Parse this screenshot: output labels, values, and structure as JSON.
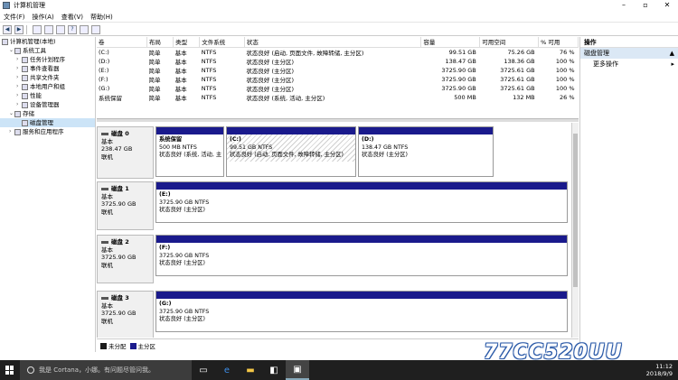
{
  "window": {
    "title": "计算机管理"
  },
  "menu": [
    "文件(F)",
    "操作(A)",
    "查看(V)",
    "帮助(H)"
  ],
  "tree": [
    {
      "label": "计算机管理(本地)",
      "level": 0,
      "icon": "computer-icon"
    },
    {
      "label": "系统工具",
      "level": 1,
      "icon": "tools-icon"
    },
    {
      "label": "任务计划程序",
      "level": 2,
      "icon": "clock-icon"
    },
    {
      "label": "事件查看器",
      "level": 2,
      "icon": "log-icon"
    },
    {
      "label": "共享文件夹",
      "level": 2,
      "icon": "folder-icon"
    },
    {
      "label": "本地用户和组",
      "level": 2,
      "icon": "users-icon"
    },
    {
      "label": "性能",
      "level": 2,
      "icon": "chart-icon"
    },
    {
      "label": "设备管理器",
      "level": 2,
      "icon": "device-icon"
    },
    {
      "label": "存储",
      "level": 1,
      "icon": "storage-icon"
    },
    {
      "label": "磁盘管理",
      "level": 2,
      "icon": "disk-icon",
      "selected": true
    },
    {
      "label": "服务和应用程序",
      "level": 1,
      "icon": "services-icon"
    }
  ],
  "volumes": {
    "headers": [
      "卷",
      "布局",
      "类型",
      "文件系统",
      "状态",
      "容量",
      "可用空间",
      "% 可用"
    ],
    "rows": [
      [
        "(C:)",
        "简单",
        "基本",
        "NTFS",
        "状态良好 (启动, 页面文件, 故障转储, 主分区)",
        "99.51 GB",
        "75.26 GB",
        "76 %"
      ],
      [
        "(D:)",
        "简单",
        "基本",
        "NTFS",
        "状态良好 (主分区)",
        "138.47 GB",
        "138.36 GB",
        "100 %"
      ],
      [
        "(E:)",
        "简单",
        "基本",
        "NTFS",
        "状态良好 (主分区)",
        "3725.90 GB",
        "3725.61 GB",
        "100 %"
      ],
      [
        "(F:)",
        "简单",
        "基本",
        "NTFS",
        "状态良好 (主分区)",
        "3725.90 GB",
        "3725.61 GB",
        "100 %"
      ],
      [
        "(G:)",
        "简单",
        "基本",
        "NTFS",
        "状态良好 (主分区)",
        "3725.90 GB",
        "3725.61 GB",
        "100 %"
      ],
      [
        "系统保留",
        "简单",
        "基本",
        "NTFS",
        "状态良好 (系统, 活动, 主分区)",
        "500 MB",
        "132 MB",
        "26 %"
      ]
    ]
  },
  "disks": [
    {
      "name": "磁盘 0",
      "type": "基本",
      "size": "238.47 GB",
      "status": "联机",
      "parts": [
        {
          "title": "系统保留",
          "size": "500 MB NTFS",
          "status": "状态良好 (系统, 活动, 主",
          "hatch": false
        },
        {
          "title": "(C:)",
          "size": "99.51 GB NTFS",
          "status": "状态良好 (启动, 页面文件, 故障转储, 主分区)",
          "hatch": true
        },
        {
          "title": "(D:)",
          "size": "138.47 GB NTFS",
          "status": "状态良好 (主分区)",
          "hatch": false
        }
      ]
    },
    {
      "name": "磁盘 1",
      "type": "基本",
      "size": "3725.90 GB",
      "status": "联机",
      "parts": [
        {
          "title": "(E:)",
          "size": "3725.90 GB NTFS",
          "status": "状态良好 (主分区)",
          "hatch": false
        }
      ]
    },
    {
      "name": "磁盘 2",
      "type": "基本",
      "size": "3725.90 GB",
      "status": "联机",
      "parts": [
        {
          "title": "(F:)",
          "size": "3725.90 GB NTFS",
          "status": "状态良好 (主分区)",
          "hatch": false
        }
      ]
    },
    {
      "name": "磁盘 3",
      "type": "基本",
      "size": "3725.90 GB",
      "status": "联机",
      "parts": [
        {
          "title": "(G:)",
          "size": "3725.90 GB NTFS",
          "status": "状态良好 (主分区)",
          "hatch": false
        }
      ]
    }
  ],
  "legend": [
    {
      "label": "未分配",
      "color": "#1a1a1a"
    },
    {
      "label": "主分区",
      "color": "#1a1a8c"
    }
  ],
  "actions": {
    "header": "操作",
    "section": "磁盘管理",
    "more": "更多操作"
  },
  "taskbar": {
    "search_placeholder": "我是 Cortana，小娜。有问题尽管问我。",
    "time": "11:12",
    "date": "2018/9/9"
  },
  "watermark": "77CC520UU"
}
